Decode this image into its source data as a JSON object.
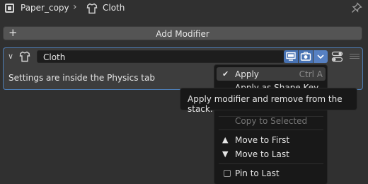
{
  "breadcrumb": {
    "object_name": "Paper_copy",
    "separator": "›",
    "modifier_name": "Cloth"
  },
  "add_modifier": {
    "icon": "+",
    "label": "Add Modifier"
  },
  "modifier_panel": {
    "collapse_icon": "chevron-down-icon",
    "name_value": "Cloth",
    "info_text": "Settings are inside the Physics tab",
    "accent": "#4772b3"
  },
  "menu": {
    "apply": {
      "label": "Apply",
      "shortcut": "Ctrl A"
    },
    "apply_shape_key": {
      "label": "Apply as Shape Key"
    },
    "copy_to_selected": {
      "label": "Copy to Selected"
    },
    "move_to_first": {
      "label": "Move to First"
    },
    "move_to_last": {
      "label": "Move to Last"
    },
    "pin_to_last": {
      "label": "Pin to Last"
    }
  },
  "tooltip": {
    "text": "Apply modifier and remove from the stack."
  }
}
